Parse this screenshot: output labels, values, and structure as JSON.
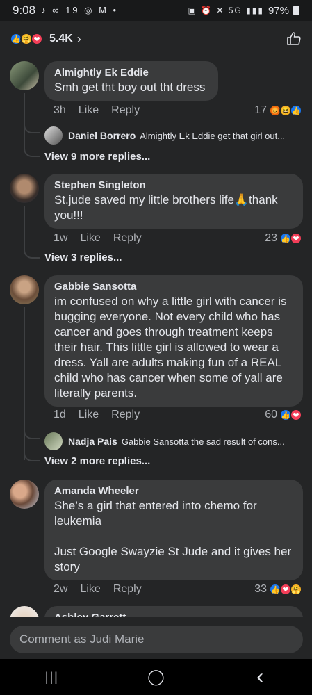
{
  "status": {
    "time": "9:08",
    "left_icons": "♪ ∞ 19 ◎ M •",
    "right_icons": "▣ ⏰ ✕ 5G ▮▮▮",
    "battery": "97%"
  },
  "reactions_bar": {
    "count": "5.4K",
    "chevron": "›"
  },
  "comments": [
    {
      "name": "Almightly Ek Eddie",
      "text": "Smh get tht boy out tht dress",
      "time": "3h",
      "like": "Like",
      "reply": "Reply",
      "reaction_count": "17",
      "reply_preview": {
        "name": "Daniel Borrero",
        "text": "Almightly Ek Eddie get that girl out..."
      },
      "view_more": "View 9 more replies..."
    },
    {
      "name": "Stephen Singleton",
      "text": "St.jude saved my little brothers life🙏thank you!!!",
      "time": "1w",
      "like": "Like",
      "reply": "Reply",
      "reaction_count": "23",
      "view_more": "View 3 replies..."
    },
    {
      "name": "Gabbie Sansotta",
      "text": "im confused on why a little girl with cancer is bugging everyone. Not every child who has cancer and goes through treatment keeps their hair. This little girl is allowed to wear a dress. Yall are adults making fun of a REAL child who has cancer when some of yall are literally parents.",
      "time": "1d",
      "like": "Like",
      "reply": "Reply",
      "reaction_count": "60",
      "reply_preview": {
        "name": "Nadja Pais",
        "text": "Gabbie Sansotta the sad result of cons..."
      },
      "view_more": "View 2 more replies..."
    },
    {
      "name": "Amanda Wheeler",
      "text": "She’s a girl that entered into chemo for leukemia\n\nJust Google Swayzie St Jude and it gives her story",
      "time": "2w",
      "like": "Like",
      "reply": "Reply",
      "reaction_count": "33"
    },
    {
      "name": "Ashley Garrett"
    }
  ],
  "composer": {
    "placeholder": "Comment as Judi Marie"
  },
  "nav": {
    "recent": "|||",
    "home": "◯",
    "back": "‹"
  },
  "colors": {
    "background": "#242526",
    "bubble": "#3a3b3c",
    "like_blue": "#1877f2",
    "love_red": "#f33e58",
    "haha_yellow": "#f7b125"
  }
}
